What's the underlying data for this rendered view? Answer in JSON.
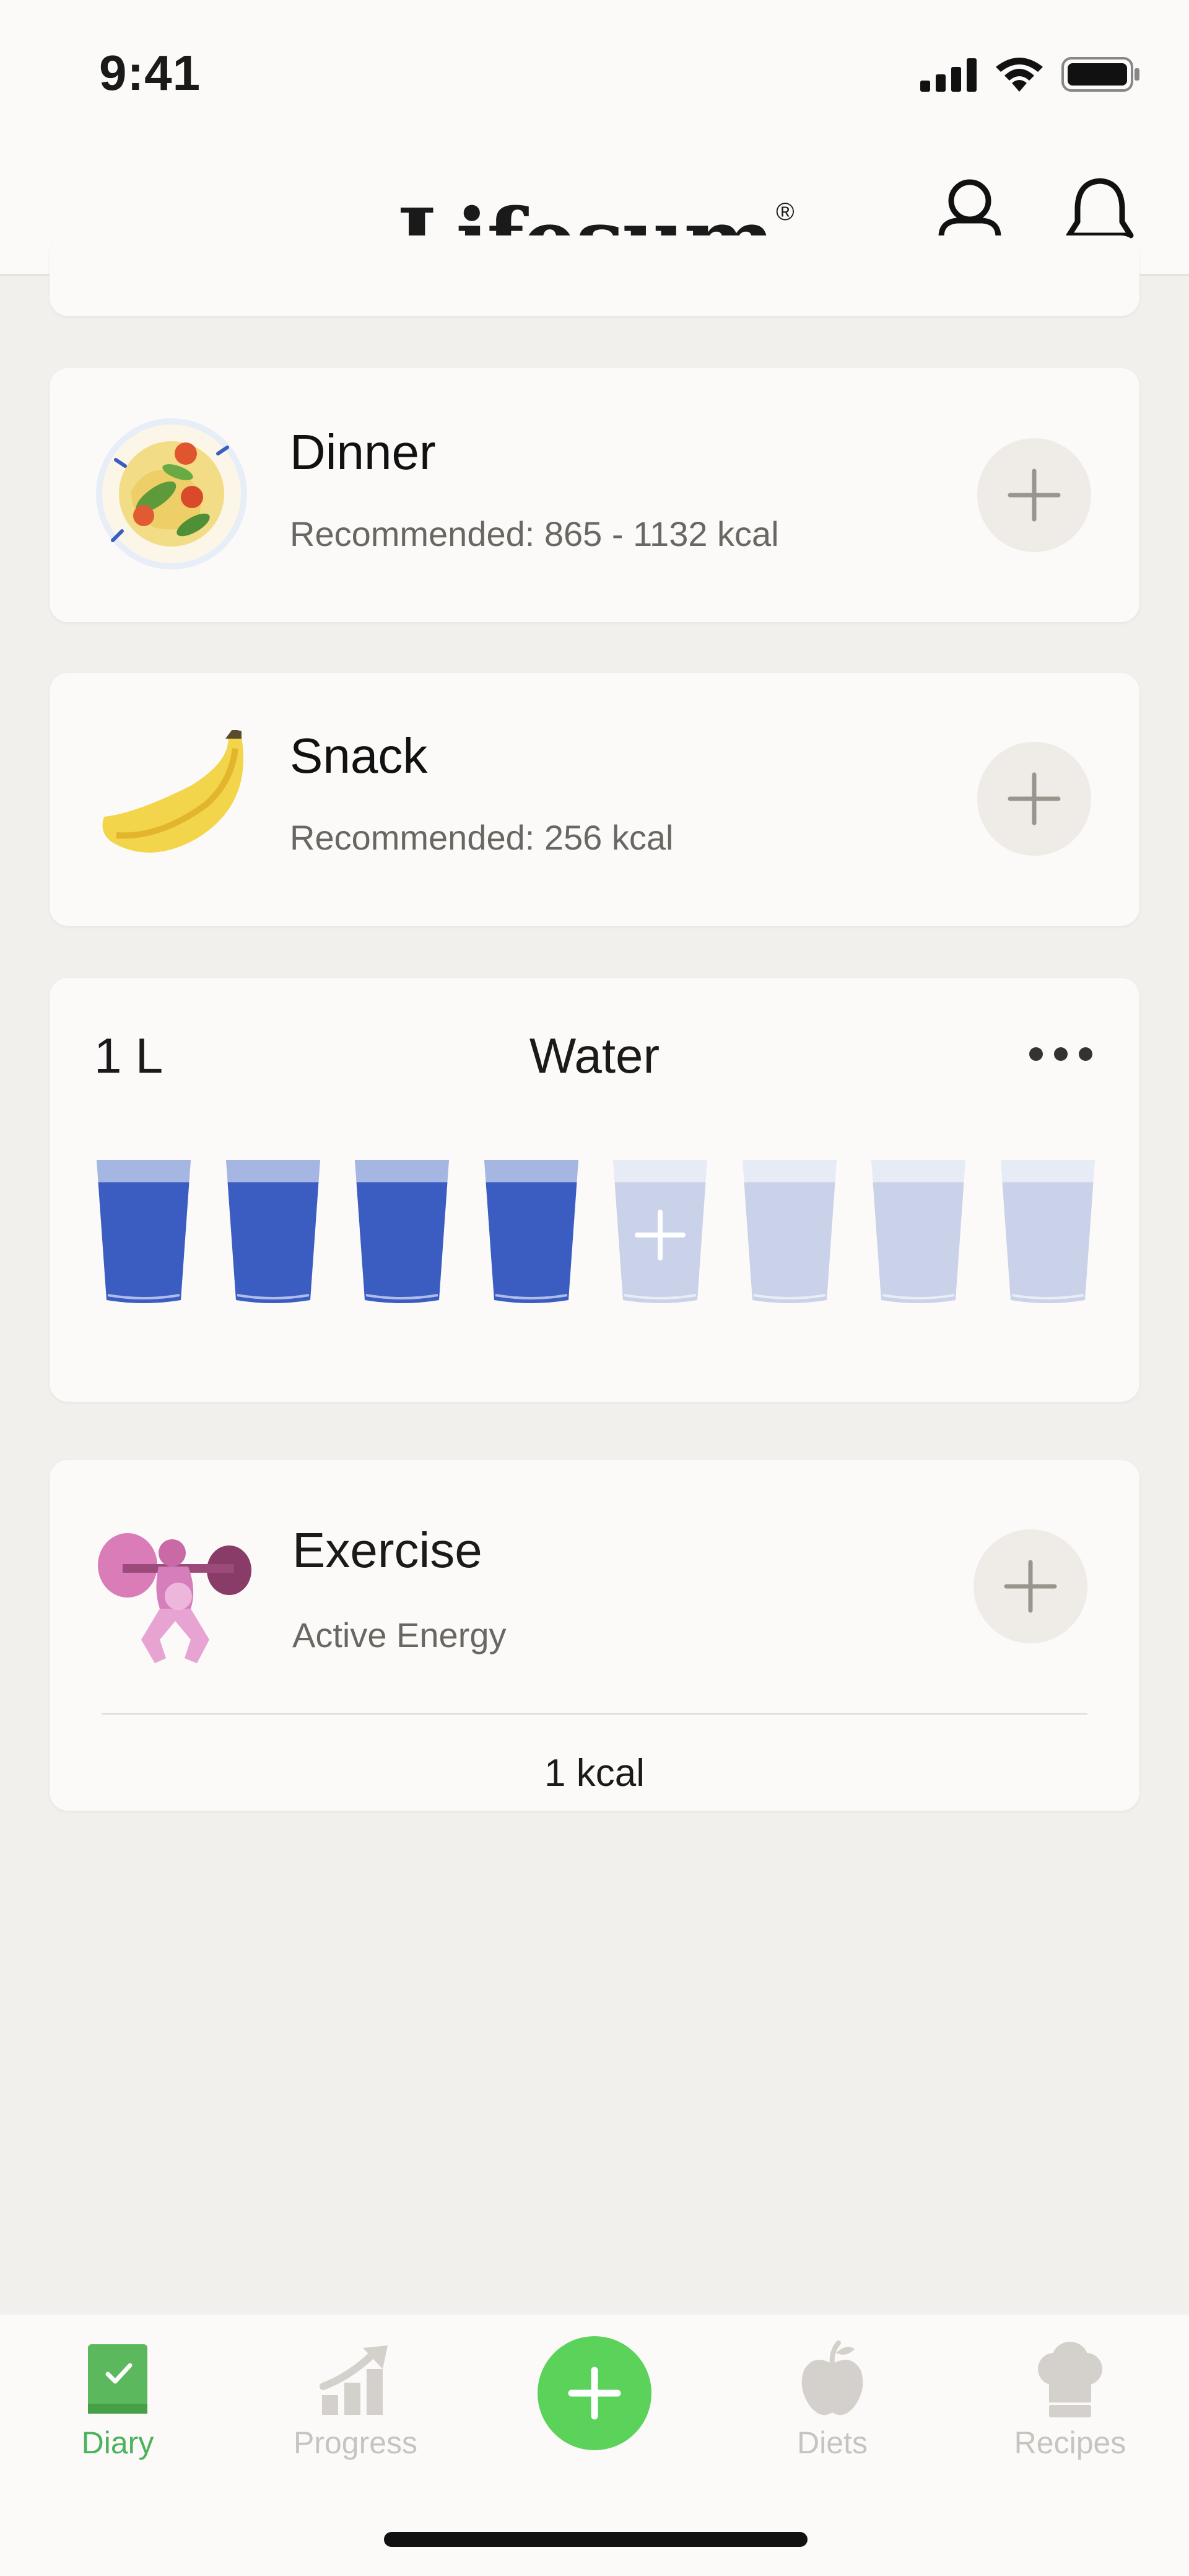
{
  "status_bar": {
    "time": "9:41"
  },
  "header": {
    "logo": "Lifesum",
    "registered": "®",
    "icons": [
      "profile-icon",
      "bell-icon"
    ]
  },
  "meals": [
    {
      "title": "Dinner",
      "subtitle": "Recommended: 865 - 1132  kcal",
      "icon": "pasta-plate-icon"
    },
    {
      "title": "Snack",
      "subtitle": "Recommended: 256  kcal",
      "icon": "banana-icon"
    }
  ],
  "water": {
    "amount": "1 L",
    "title": "Water",
    "glasses_total": 8,
    "glasses_filled": 4,
    "colors": {
      "filled": "#2a4fbd",
      "empty": "#b9c4e4"
    }
  },
  "exercise": {
    "title": "Exercise",
    "subtitle": "Active Energy",
    "kcal": "1 kcal",
    "icon": "weightlifter-icon"
  },
  "tabbar": {
    "tabs": [
      {
        "label": "Diary",
        "icon": "diary-icon",
        "active": true
      },
      {
        "label": "Progress",
        "icon": "progress-chart-icon",
        "active": false
      },
      {
        "label": "Diets",
        "icon": "apple-icon",
        "active": false
      },
      {
        "label": "Recipes",
        "icon": "chef-hat-icon",
        "active": false
      }
    ],
    "fab_icon": "plus-icon"
  },
  "colors": {
    "accent_green": "#5bd25a",
    "active_tab_label": "#4cb35c",
    "background": "#f2f0ed",
    "card": "#fbfaf8"
  }
}
